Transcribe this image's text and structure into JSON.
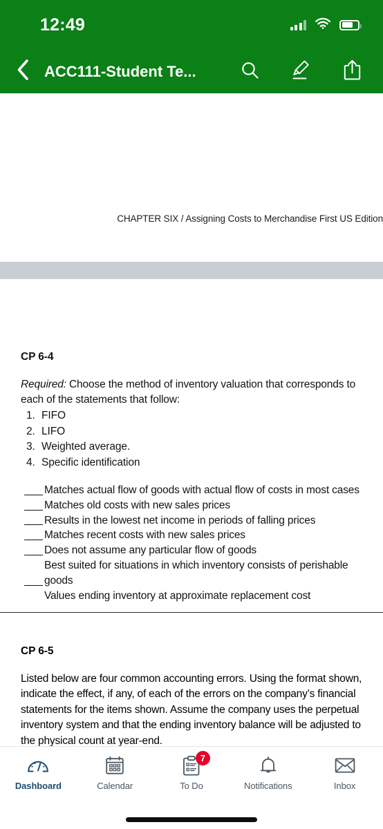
{
  "status_bar": {
    "time": "12:49",
    "signal_icon": "cellular-signal-icon",
    "wifi_icon": "wifi-icon",
    "battery_icon": "battery-icon"
  },
  "nav_bar": {
    "back_icon": "chevron-left-icon",
    "title": "ACC111-Student Te...",
    "search_icon": "search-icon",
    "annotate_icon": "highlighter-pen-icon",
    "share_icon": "share-upload-icon",
    "background_color": "#0a8017"
  },
  "document": {
    "running_head": "CHAPTER SIX / Assigning Costs to Merchandise First US Edition",
    "section_one": {
      "heading": "CP 6-4",
      "required_label": "Required:",
      "required_text": " Choose the method of inventory valuation that corresponds to each of the statements that follow:",
      "methods": [
        {
          "number": "1.",
          "label": "FIFO"
        },
        {
          "number": "2.",
          "label": "LIFO"
        },
        {
          "number": "3.",
          "label": "Weighted average."
        },
        {
          "number": "4.",
          "label": "Specific identification"
        }
      ],
      "statements": [
        "Matches actual flow of goods with actual flow of costs in most cases",
        "Matches old costs with new sales prices",
        "Results in the lowest net income in periods of falling prices",
        "Matches recent costs with new sales prices",
        "Does not assume any particular flow of goods",
        "Best suited for situations in which inventory consists of perishable goods",
        "Values ending inventory at approximate replacement cost"
      ]
    },
    "section_two": {
      "heading": "CP 6-5",
      "body": "Listed below are four common accounting errors. Using the format shown, indicate the effect, if any, of each of the errors on the company’s financial statements for the items shown. Assume the company uses the perpetual inventory system and that the ending inventory balance will be adjusted to the physical count at year-end."
    }
  },
  "tab_bar": {
    "active_color": "#1d4d72",
    "inactive_color": "#4a5761",
    "badge_color": "#e4002b",
    "items": [
      {
        "label": "Dashboard",
        "icon": "dashboard-gauge-icon",
        "active": true,
        "badge": ""
      },
      {
        "label": "Calendar",
        "icon": "calendar-icon",
        "active": false,
        "badge": ""
      },
      {
        "label": "To Do",
        "icon": "clipboard-checklist-icon",
        "active": false,
        "badge": "7"
      },
      {
        "label": "Notifications",
        "icon": "bell-icon",
        "active": false,
        "badge": ""
      },
      {
        "label": "Inbox",
        "icon": "envelope-icon",
        "active": false,
        "badge": ""
      }
    ]
  }
}
